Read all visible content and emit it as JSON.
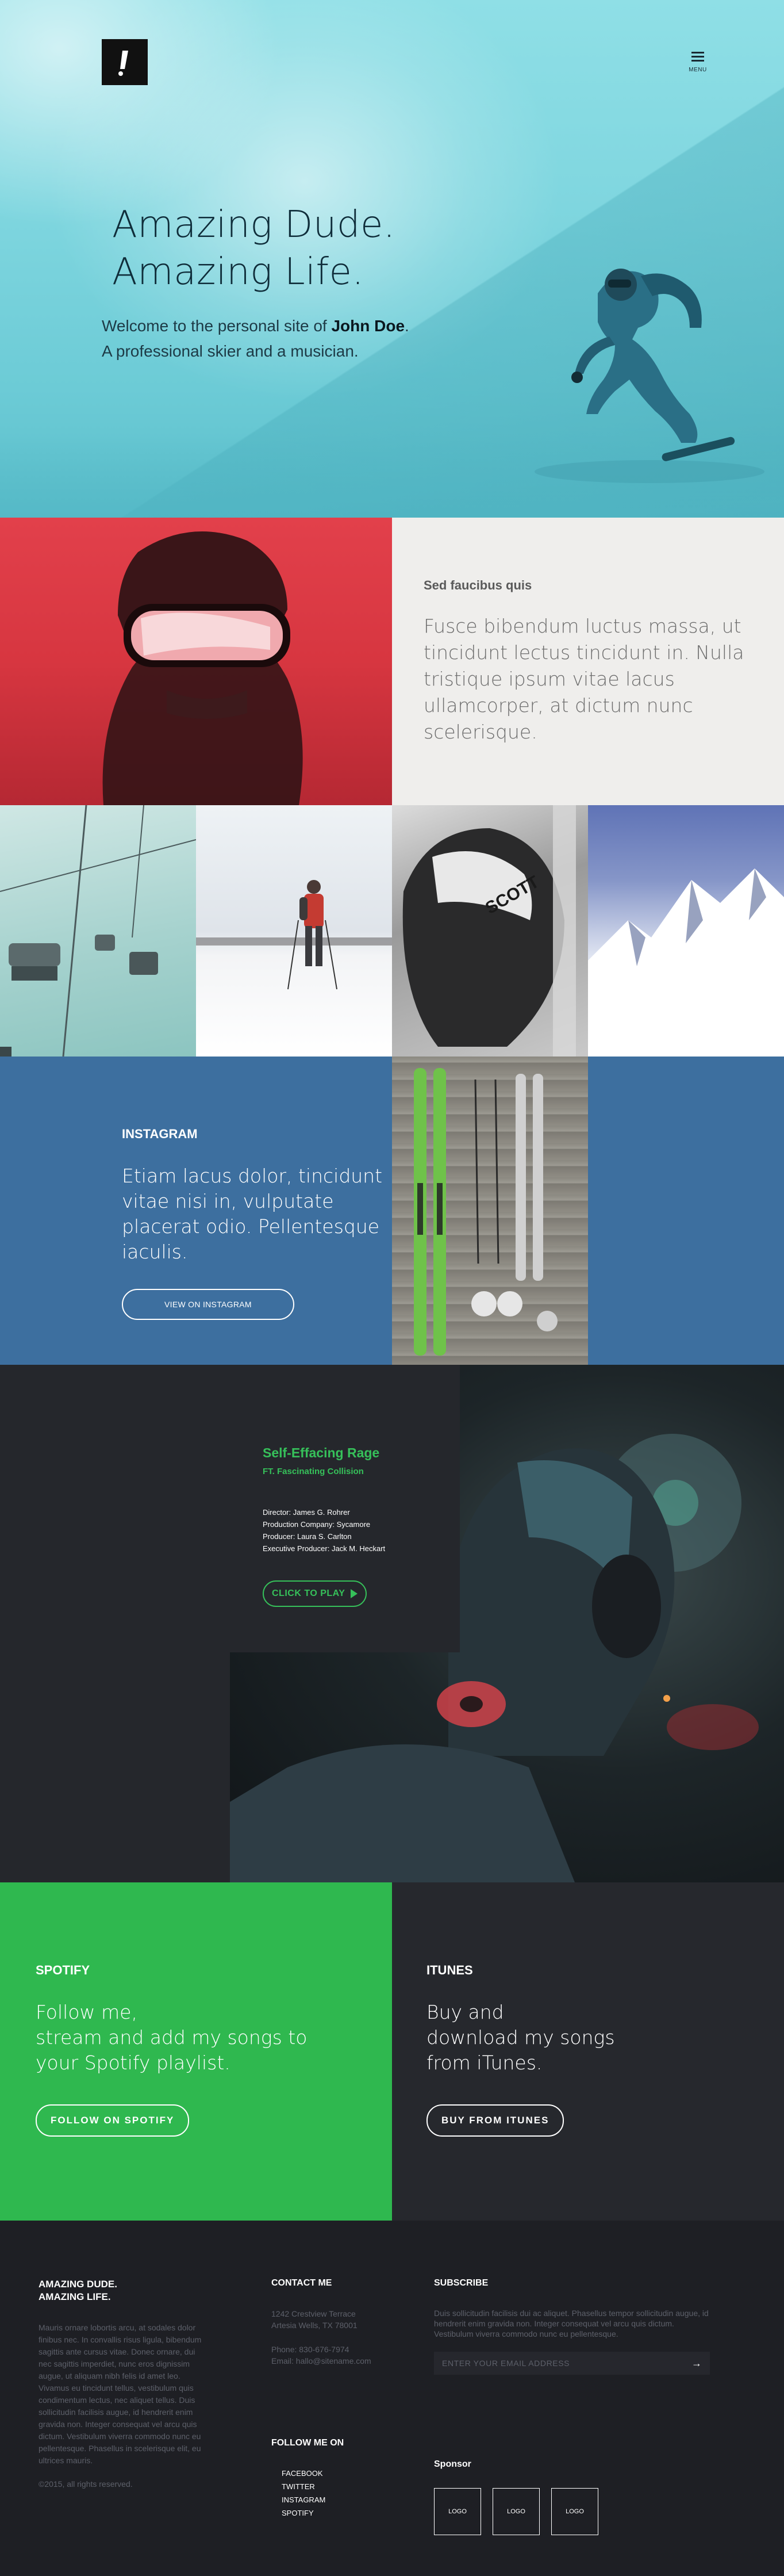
{
  "nav": {
    "menu_label": "MENU"
  },
  "hero": {
    "headline_line1": "Amazing Dude.",
    "headline_line2": "Amazing Life.",
    "tagline_prefix": "Welcome to the personal site of ",
    "tagline_name": "John Doe",
    "tagline_suffix": ".",
    "tagline_line2": "A professional skier and a musician."
  },
  "feature": {
    "eyebrow": "Sed faucibus quis",
    "body": "Fusce bibendum luctus massa, ut tincidunt lectus tincidunt in. Nulla tristique ipsum vitae lacus ullamcorper, at dictum nunc scelerisque."
  },
  "instagram": {
    "title": "INSTAGRAM",
    "body": "Etiam lacus dolor, tincidunt vitae nisi in, vulputate placerat odio. Pellentesque iaculis.",
    "button": "VIEW ON INSTAGRAM"
  },
  "music": {
    "title": "Self-Effacing Rage",
    "subtitle": "FT. Fascinating Collision",
    "credits": [
      "Director: James G. Rohrer",
      "Production Company: Sycamore",
      "Producer: Laura S. Carlton",
      "Executive Producer: Jack M. Heckart"
    ],
    "play_button": "CLICK TO PLAY"
  },
  "spotify": {
    "title": "SPOTIFY",
    "body_line1": "Follow me,",
    "body_line2": "stream and add my songs to",
    "body_line3": "your Spotify playlist.",
    "button": "FOLLOW ON SPOTIFY"
  },
  "itunes": {
    "title": "ITUNES",
    "body_line1": "Buy and",
    "body_line2": "download my songs",
    "body_line3": "from iTunes.",
    "button": "BUY FROM ITUNES"
  },
  "footer": {
    "about_title_line1": "AMAZING DUDE.",
    "about_title_line2": "AMAZING LIFE.",
    "about_body": "Mauris ornare lobortis arcu, at sodales dolor finibus nec. In convallis risus ligula, bibendum sagittis ante cursus vitae. Donec ornare, dui nec sagittis imperdiet, nunc eros dignissim augue, ut aliquam nibh felis id amet leo. Vivamus eu tincidunt tellus, vestibulum quis condimentum lectus, nec aliquet tellus. Duis sollicitudin facilisis augue, id hendrerit enim gravida non. Integer consequat vel arcu quis dictum. Vestibulum viverra commodo nunc eu pellentesque. Phasellus in scelerisque elit, eu ultrices mauris.",
    "copyright": "©2015, all rights reserved.",
    "contact_title": "CONTACT ME",
    "address_line1": "1242 Crestview Terrace",
    "address_line2": "Artesia Wells, TX 78001",
    "phone": "Phone: 830-676-7974",
    "email": "Email: hallo@sitename.com",
    "follow_title": "FOLLOW ME ON",
    "social": [
      "FACEBOOK",
      "TWITTER",
      "INSTAGRAM",
      "SPOTIFY"
    ],
    "subscribe_title": "SUBSCRIBE",
    "subscribe_body": "Duis sollicitudin facilisis dui ac aliquet. Phasellus tempor sollicitudin augue, id hendrerit enim gravida non. Integer consequat vel arcu quis dictum. Vestibulum viverra commodo nunc eu pellentesque.",
    "email_placeholder": "ENTER YOUR EMAIL ADDRESS",
    "sponsor_title": "Sponsor",
    "sponsor_logos": [
      "LOGO",
      "LOGO",
      "LOGO"
    ]
  },
  "colors": {
    "spotify_green": "#2fb84f",
    "instagram_blue": "#3d6f9f",
    "dark": "#25272c",
    "footer_dark": "#1e1f24",
    "feature_red": "#e2404b"
  }
}
